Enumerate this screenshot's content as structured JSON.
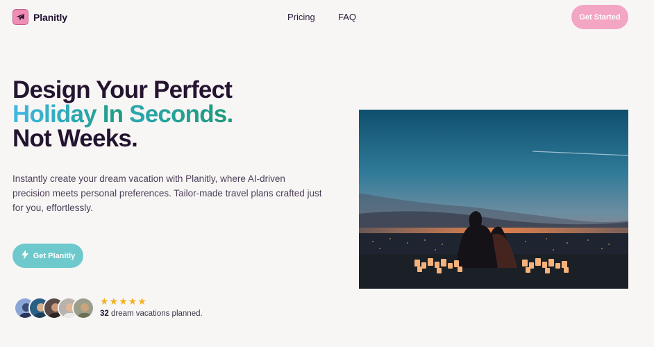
{
  "brand": {
    "name": "Planitly",
    "icon": "airplane-icon",
    "color": "#f08db4"
  },
  "nav": {
    "items": [
      "Pricing",
      "FAQ"
    ]
  },
  "header": {
    "cta_label": "Get Started"
  },
  "hero": {
    "headline_line1": "Design Your Perfect",
    "headline_line2_a": "Holiday In ",
    "headline_line2_b": "Seconds.",
    "headline_line3": "Not Weeks.",
    "description": "Instantly create your dream vacation with Planitly, where AI-driven precision meets personal preferences. Tailor-made travel plans crafted just for you, effortlessly.",
    "cta_label": "Get Planitly",
    "cta_icon": "lightning-icon",
    "image": "couple-sunset-city-photo"
  },
  "social_proof": {
    "stars": "★★★★★",
    "rating": 5,
    "count": "32",
    "label": " dream vacations planned."
  },
  "colors": {
    "background": "#f8f6f5",
    "headline": "#24142f",
    "gradient_start": "#3fb9e3",
    "gradient_end": "#1c9a78",
    "cta_pink": "#f3a6c3",
    "cta_teal": "#6ec9cc",
    "star": "#f2b01e"
  }
}
